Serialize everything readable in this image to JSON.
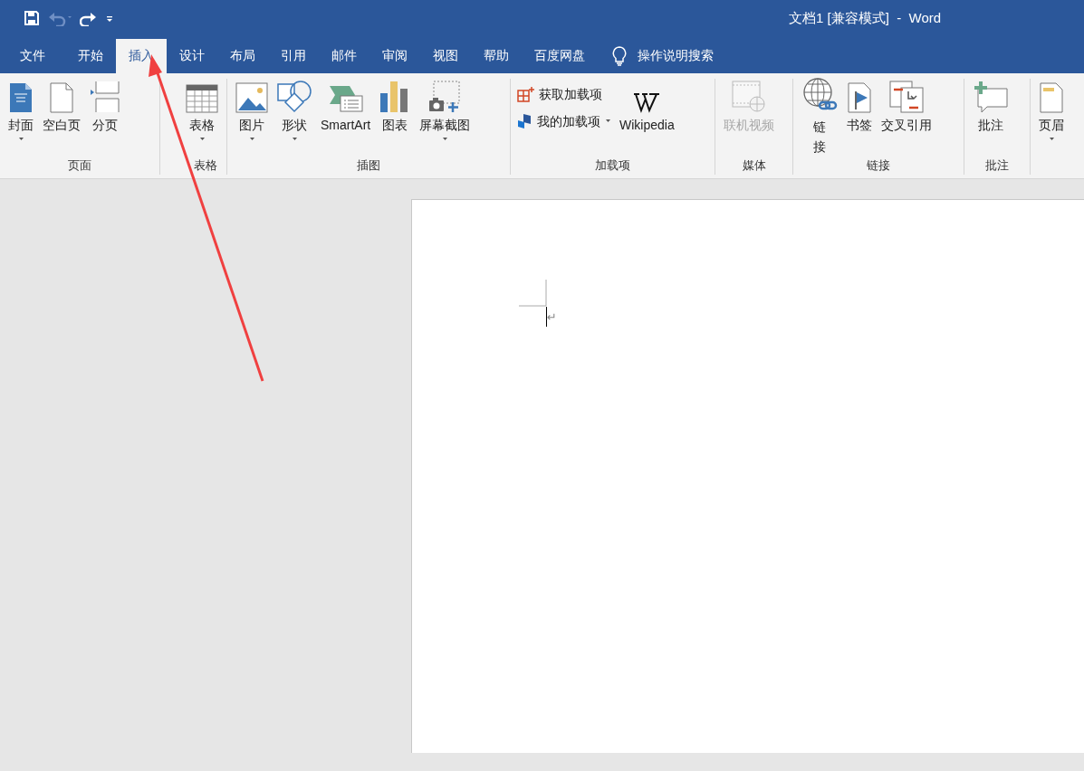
{
  "window": {
    "title": "文档1 [兼容模式]  -  Word"
  },
  "quick_access": [
    {
      "kind": "save",
      "disabled": false
    },
    {
      "kind": "undo",
      "disabled": true
    },
    {
      "kind": "redo",
      "disabled": false
    },
    {
      "kind": "customize",
      "disabled": false
    }
  ],
  "tabs": [
    {
      "label": "文件",
      "selected": false
    },
    {
      "label": "开始",
      "selected": false
    },
    {
      "label": "插入",
      "selected": true
    },
    {
      "label": "设计",
      "selected": false
    },
    {
      "label": "布局",
      "selected": false
    },
    {
      "label": "引用",
      "selected": false
    },
    {
      "label": "邮件",
      "selected": false
    },
    {
      "label": "审阅",
      "selected": false
    },
    {
      "label": "视图",
      "selected": false
    },
    {
      "label": "帮助",
      "selected": false
    },
    {
      "label": "百度网盘",
      "selected": false
    }
  ],
  "tell_me": {
    "placeholder": "操作说明搜索"
  },
  "ribbon_groups": [
    {
      "label": "页面",
      "buttons": [
        {
          "kind": "large",
          "label": "封面",
          "dropdown": true,
          "disabled": false
        },
        {
          "kind": "large",
          "label": "空白页",
          "dropdown": false,
          "disabled": false
        },
        {
          "kind": "large",
          "label": "分页",
          "dropdown": false,
          "disabled": false
        }
      ]
    },
    {
      "label": "表格",
      "buttons": [
        {
          "kind": "large",
          "label": "表格",
          "dropdown": true,
          "disabled": false
        }
      ]
    },
    {
      "label": "插图",
      "buttons": [
        {
          "kind": "large",
          "label": "图片",
          "dropdown": true,
          "disabled": false
        },
        {
          "kind": "large",
          "label": "形状",
          "dropdown": true,
          "disabled": false
        },
        {
          "kind": "large",
          "label": "SmartArt",
          "dropdown": false,
          "disabled": false
        },
        {
          "kind": "large",
          "label": "图表",
          "dropdown": false,
          "disabled": false
        },
        {
          "kind": "large",
          "label": "屏幕截图",
          "dropdown": true,
          "disabled": false
        }
      ]
    },
    {
      "label": "加载项",
      "buttons": [
        {
          "kind": "small",
          "label": "获取加载项",
          "dropdown": false,
          "disabled": false
        },
        {
          "kind": "small",
          "label": "我的加载项",
          "dropdown": true,
          "disabled": false
        },
        {
          "kind": "large",
          "label": "Wikipedia",
          "dropdown": false,
          "disabled": false
        }
      ]
    },
    {
      "label": "媒体",
      "buttons": [
        {
          "kind": "large",
          "label": "联机视频",
          "dropdown": false,
          "disabled": true
        }
      ]
    },
    {
      "label": "链接",
      "buttons": [
        {
          "kind": "stacked",
          "label": "链接",
          "dropdown": false,
          "disabled": false
        },
        {
          "kind": "large",
          "label": "书签",
          "dropdown": false,
          "disabled": false
        },
        {
          "kind": "large",
          "label": "交叉引用",
          "dropdown": false,
          "disabled": false
        }
      ]
    },
    {
      "label": "批注",
      "buttons": [
        {
          "kind": "large",
          "label": "批注",
          "dropdown": false,
          "disabled": false
        }
      ]
    },
    {
      "buttons": [
        {
          "kind": "large",
          "label": "页眉",
          "dropdown": true,
          "disabled": false
        }
      ]
    }
  ],
  "document": {
    "paragraph_mark": "↵"
  },
  "annotation": {
    "kind": "arrow"
  }
}
